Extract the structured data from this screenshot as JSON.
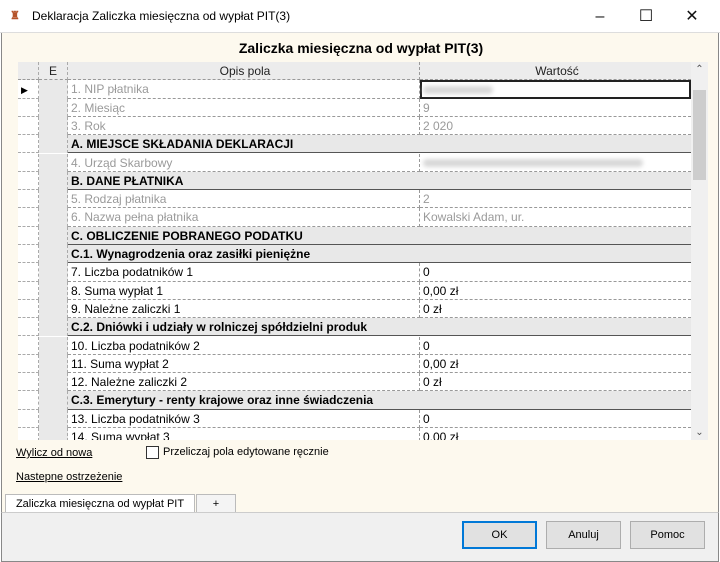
{
  "window": {
    "title": "Deklaracja Zaliczka miesięczna od wypłat PIT(3)",
    "icon": "app-logo-icon",
    "minimize": "–",
    "maximize": "☐",
    "close": "✕"
  },
  "heading": "Zaliczka miesięczna od wypłat PIT(3)",
  "grid": {
    "headers": {
      "e": "E",
      "opis": "Opis pola",
      "wartosc": "Wartość"
    },
    "rows": [
      {
        "type": "field",
        "label": "1. NIP płatnika",
        "value": "",
        "readonly": true,
        "blurred": true,
        "selected": true
      },
      {
        "type": "field",
        "label": "2. Miesiąc",
        "value": "9",
        "readonly": true
      },
      {
        "type": "field",
        "label": "3. Rok",
        "value": "2 020",
        "readonly": true
      },
      {
        "type": "section",
        "label": "A. MIEJSCE SKŁADANIA DEKLARACJI"
      },
      {
        "type": "field",
        "label": "4. Urząd Skarbowy",
        "value": "",
        "readonly": true,
        "blurred": true
      },
      {
        "type": "section",
        "label": "B. DANE PŁATNIKA"
      },
      {
        "type": "field",
        "label": "5. Rodzaj płatnika",
        "value": "2",
        "readonly": true
      },
      {
        "type": "field",
        "label": "6. Nazwa pełna płatnika",
        "value": "Kowalski Adam, ur.",
        "readonly": true
      },
      {
        "type": "section",
        "label": "C. OBLICZENIE POBRANEGO PODATKU"
      },
      {
        "type": "section",
        "label": "C.1. Wynagrodzenia oraz zasiłki pieniężne"
      },
      {
        "type": "field",
        "label": "7. Liczba podatników 1",
        "value": "0"
      },
      {
        "type": "field",
        "label": "8. Suma wypłat 1",
        "value": "0,00 zł"
      },
      {
        "type": "field",
        "label": "9. Należne zaliczki 1",
        "value": "0 zł"
      },
      {
        "type": "section",
        "label": "C.2. Dniówki i udziały w rolniczej spółdzielni produk"
      },
      {
        "type": "field",
        "label": "10. Liczba podatników 2",
        "value": "0"
      },
      {
        "type": "field",
        "label": "11. Suma wypłat 2",
        "value": "0,00 zł"
      },
      {
        "type": "field",
        "label": "12. Należne zaliczki 2",
        "value": "0 zł"
      },
      {
        "type": "section",
        "label": "C.3. Emerytury - renty krajowe oraz inne świadczenia"
      },
      {
        "type": "field",
        "label": "13. Liczba podatników 3",
        "value": "0"
      },
      {
        "type": "field",
        "label": "14. Suma wypłat 3",
        "value": "0,00 zł"
      }
    ]
  },
  "links": {
    "recalc": "Wylicz od nowa",
    "next_warning": "Nastepne ostrzeżenie"
  },
  "checkbox": {
    "label": "Przeliczaj pola edytowane ręcznie",
    "checked": false
  },
  "tabs": [
    {
      "label": "Zaliczka miesięczna od wypłat PIT",
      "active": true
    },
    {
      "label": "+"
    }
  ],
  "buttons": {
    "ok": "OK",
    "cancel": "Anuluj",
    "help": "Pomoc"
  }
}
